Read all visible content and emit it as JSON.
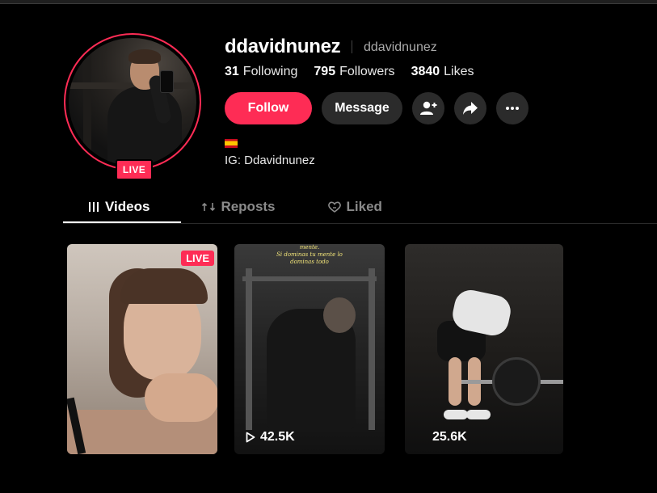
{
  "profile": {
    "username": "ddavidnunez",
    "nickname": "ddavidnunez",
    "live_label": "LIVE",
    "bio_flag": "es-flag",
    "bio_text": "IG: Ddavidnunez"
  },
  "stats": {
    "following_count": "31",
    "following_label": "Following",
    "followers_count": "795",
    "followers_label": "Followers",
    "likes_count": "3840",
    "likes_label": "Likes"
  },
  "actions": {
    "follow_label": "Follow",
    "message_label": "Message",
    "icons": [
      "add-friend-icon",
      "share-icon",
      "more-icon"
    ]
  },
  "tabs": [
    {
      "label": "Videos",
      "icon": "grid-icon",
      "active": true
    },
    {
      "label": "Reposts",
      "icon": "repost-icon",
      "active": false
    },
    {
      "label": "Liked",
      "icon": "liked-icon",
      "active": false
    }
  ],
  "videos": [
    {
      "live_label": "LIVE",
      "views": ""
    },
    {
      "caption": "mente.\nSi dominas tu mente lo\ndominas todo",
      "views": "42.5K"
    },
    {
      "views": "25.6K"
    }
  ],
  "colors": {
    "accent": "#fe2c55",
    "background": "#000000",
    "button_secondary": "#2b2b2b"
  }
}
